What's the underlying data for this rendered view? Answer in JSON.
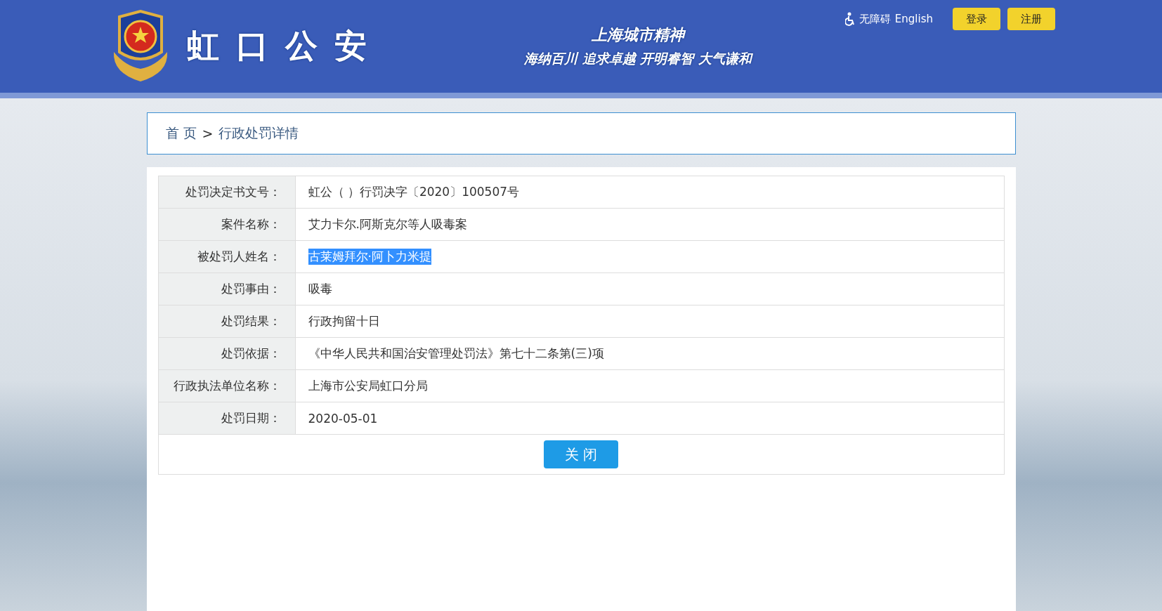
{
  "header": {
    "site_title": "虹口公安",
    "slogan_title": "上海城市精神",
    "slogan": "海纳百川 追求卓越 开明睿智 大气谦和",
    "accessibility_link": "无障碍",
    "language_link": "English",
    "buttons": [
      "登录",
      "注册"
    ]
  },
  "breadcrumb": {
    "home": "首 页",
    "separator": ">",
    "current": "行政处罚详情"
  },
  "details": [
    {
      "label": "处罚决定书文号：",
      "value": "虹公（ ）行罚决字〔2020〕100507号",
      "highlighted": false
    },
    {
      "label": "案件名称：",
      "value": "艾力卡尔.阿斯克尔等人吸毒案",
      "highlighted": false
    },
    {
      "label": "被处罚人姓名：",
      "value": "古莱姆拜尔·阿卜力米提",
      "highlighted": true
    },
    {
      "label": "处罚事由：",
      "value": "吸毒",
      "highlighted": false
    },
    {
      "label": "处罚结果：",
      "value": "行政拘留十日",
      "highlighted": false
    },
    {
      "label": "处罚依据：",
      "value": "《中华人民共和国治安管理处罚法》第七十二条第(三)项",
      "highlighted": false
    },
    {
      "label": "行政执法单位名称：",
      "value": "上海市公安局虹口分局",
      "highlighted": false
    },
    {
      "label": "处罚日期：",
      "value": "2020-05-01",
      "highlighted": false
    }
  ],
  "close_button": "关 闭"
}
